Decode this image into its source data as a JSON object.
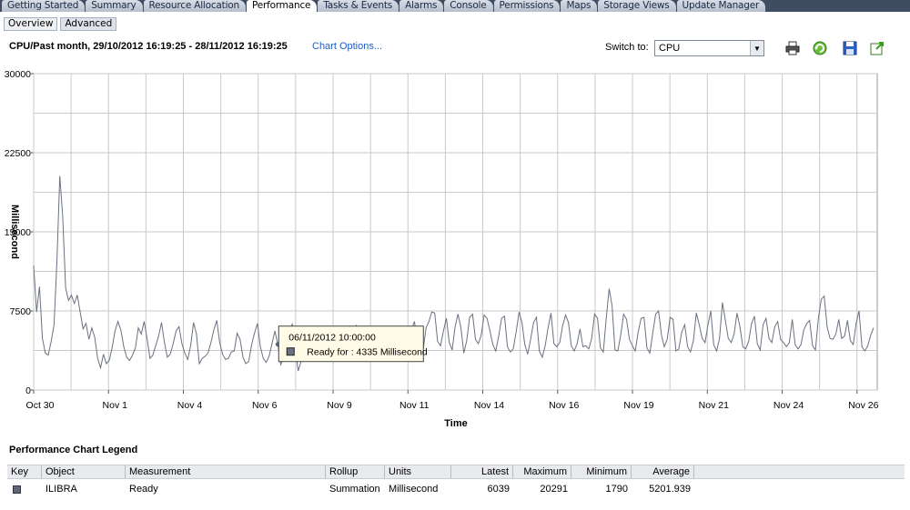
{
  "tabs": [
    {
      "label": "Getting Started",
      "active": false
    },
    {
      "label": "Summary",
      "active": false
    },
    {
      "label": "Resource Allocation",
      "active": false
    },
    {
      "label": "Performance",
      "active": true
    },
    {
      "label": "Tasks & Events",
      "active": false
    },
    {
      "label": "Alarms",
      "active": false
    },
    {
      "label": "Console",
      "active": false
    },
    {
      "label": "Permissions",
      "active": false
    },
    {
      "label": "Maps",
      "active": false
    },
    {
      "label": "Storage Views",
      "active": false
    },
    {
      "label": "Update Manager",
      "active": false
    }
  ],
  "subtabs": [
    {
      "label": "Overview",
      "active": false
    },
    {
      "label": "Advanced",
      "active": true
    }
  ],
  "header": {
    "title": "CPU/Past month, 29/10/2012 16:19:25 - 28/11/2012 16:19:25",
    "chart_options": "Chart Options...",
    "switch_label": "Switch to:",
    "switch_value": "CPU"
  },
  "toolbar": {
    "icons": [
      "print-icon",
      "refresh-icon",
      "save-icon",
      "export-icon"
    ]
  },
  "chart_data": {
    "type": "line",
    "title": "",
    "xlabel": "Time",
    "ylabel": "Millisecond",
    "ylim": [
      0,
      30000
    ],
    "yticks": [
      "0",
      "7500",
      "15000",
      "22500",
      "30000"
    ],
    "xticks": [
      "Oct 30",
      "Nov 1",
      "Nov 4",
      "Nov 6",
      "Nov 9",
      "Nov 11",
      "Nov 14",
      "Nov 16",
      "Nov 19",
      "Nov 21",
      "Nov 24",
      "Nov 26"
    ],
    "grid": true,
    "series": [
      {
        "name": "Ready",
        "color": "#6a7180",
        "values": [
          11800,
          7400,
          9800,
          4900,
          3500,
          3300,
          4600,
          6200,
          12300,
          20300,
          16500,
          9700,
          8500,
          9000,
          8200,
          9000,
          7400,
          5800,
          6300,
          4800,
          5900,
          5000,
          3000,
          2100,
          3400,
          2500,
          2800,
          4000,
          5600,
          6500,
          5700,
          4100,
          3100,
          2800,
          3300,
          4000,
          5900,
          5300,
          6500,
          4900,
          3000,
          3300,
          4200,
          5100,
          6400,
          4500,
          3100,
          3400,
          4400,
          5600,
          6000,
          4400,
          3500,
          2900,
          4200,
          6400,
          5300,
          2500,
          3000,
          3200,
          3500,
          4500,
          5700,
          6600,
          4500,
          3400,
          2900,
          3000,
          3600,
          3700,
          5400,
          4800,
          3100,
          2500,
          2700,
          4300,
          5400,
          6300,
          4100,
          3000,
          2600,
          3200,
          4400,
          5600,
          4335,
          2400,
          3100,
          5200,
          4800,
          6300,
          4100,
          1800,
          2700,
          3100,
          4600,
          4900,
          2700,
          3600,
          5400,
          4400,
          3200,
          4500,
          5400,
          5800,
          3200,
          3900,
          4700,
          3800,
          3000,
          4400,
          5600,
          6100,
          3900,
          3300,
          4800,
          5900,
          4300,
          3400,
          3000,
          4900,
          6000,
          4100,
          5800,
          4600,
          3500,
          4600,
          5500,
          3900,
          3000,
          4300,
          5700,
          6500,
          4700,
          4300,
          3800,
          5900,
          6500,
          7400,
          7300,
          4600,
          4200,
          5600,
          6800,
          4500,
          3800,
          6000,
          7200,
          5900,
          3500,
          4700,
          6900,
          7200,
          4800,
          4400,
          5200,
          7100,
          6800,
          5600,
          4300,
          3700,
          5100,
          6800,
          7000,
          4100,
          3600,
          3900,
          5500,
          7400,
          6400,
          4300,
          3400,
          4800,
          6400,
          6900,
          3700,
          3100,
          4200,
          5900,
          7300,
          4400,
          4100,
          4500,
          6100,
          7100,
          6400,
          4200,
          3700,
          4400,
          5800,
          4100,
          4200,
          3900,
          4900,
          7200,
          6800,
          4000,
          3600,
          6800,
          9600,
          8000,
          3800,
          3700,
          5200,
          7200,
          6700,
          4800,
          4200,
          3700,
          5500,
          6800,
          6900,
          4000,
          3500,
          5400,
          7200,
          7500,
          5200,
          4100,
          4800,
          6900,
          6700,
          3700,
          3900,
          5500,
          6200,
          4100,
          3600,
          4700,
          7300,
          6200,
          4900,
          4500,
          6200,
          7500,
          4300,
          3700,
          4900,
          8300,
          6600,
          4900,
          4500,
          5300,
          7300,
          6000,
          4100,
          3900,
          4600,
          6300,
          7000,
          4400,
          3800,
          6200,
          6800,
          4900,
          4500,
          6000,
          6500,
          4800,
          4500,
          4100,
          4500,
          6700,
          4300,
          3900,
          4300,
          5700,
          6300,
          6600,
          4200,
          3800,
          6800,
          8600,
          8900,
          6000,
          4900,
          4800,
          5300,
          6700,
          4900,
          5100,
          6600,
          4700,
          4300,
          6300,
          7500,
          4100,
          3700,
          4200,
          5200,
          5900
        ]
      }
    ],
    "tooltip": {
      "time": "06/11/2012 10:00:00",
      "text": "Ready for : 4335 Millisecond"
    }
  },
  "legend": {
    "title": "Performance Chart Legend",
    "columns": [
      "Key",
      "Object",
      "Measurement",
      "Rollup",
      "Units",
      "Latest",
      "Maximum",
      "Minimum",
      "Average"
    ],
    "rows": [
      {
        "color": "#5e6778",
        "object": "ILIBRA",
        "measurement": "Ready",
        "rollup": "Summation",
        "units": "Millisecond",
        "latest": "6039",
        "maximum": "20291",
        "minimum": "1790",
        "average": "5201.939"
      }
    ]
  }
}
